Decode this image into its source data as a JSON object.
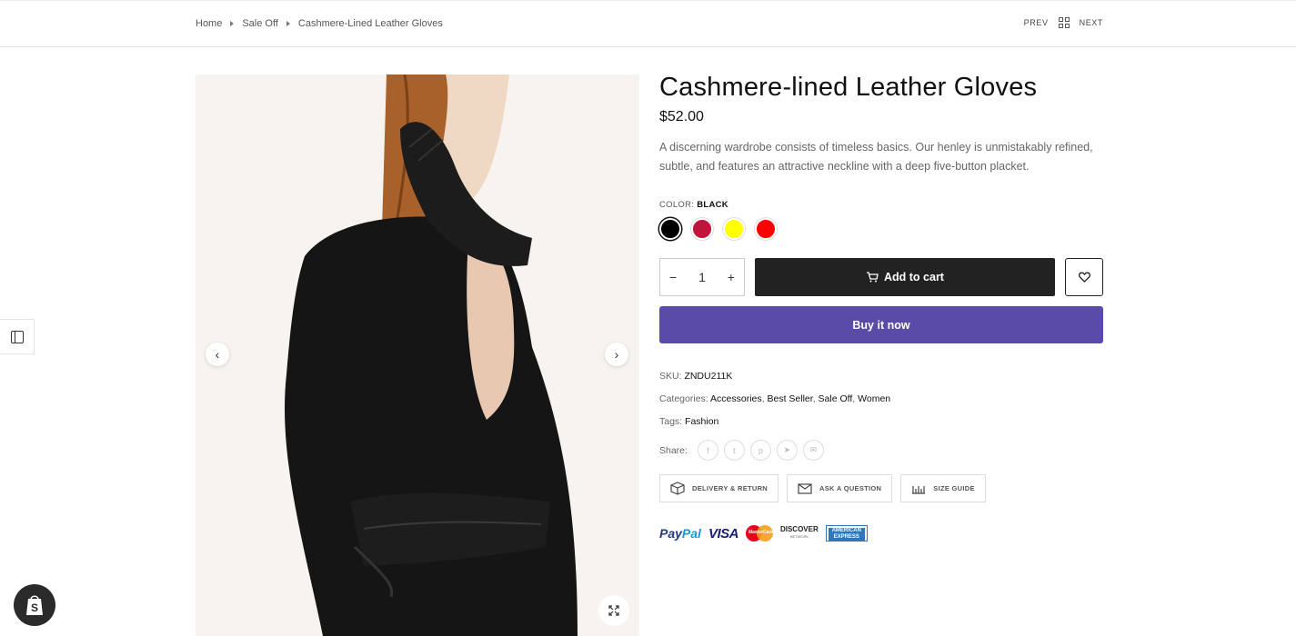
{
  "breadcrumb": {
    "items": [
      "Home",
      "Sale Off",
      "Cashmere-Lined Leather Gloves"
    ]
  },
  "pager": {
    "prev": "PREV",
    "next": "NEXT"
  },
  "product": {
    "title": "Cashmere-lined Leather Gloves",
    "price": "$52.00",
    "description": "A discerning wardrobe consists of timeless basics. Our henley is unmistakably refined, subtle, and features an attractive neckline with a deep five-button placket.",
    "color_label": "COLOR:",
    "color_value": "BLACK",
    "colors": [
      {
        "name": "black",
        "hex": "#000000",
        "selected": true
      },
      {
        "name": "crimson",
        "hex": "#c0143c",
        "selected": false
      },
      {
        "name": "yellow",
        "hex": "#ffff00",
        "selected": false
      },
      {
        "name": "red",
        "hex": "#ff0000",
        "selected": false
      }
    ],
    "quantity": "1",
    "add_to_cart": "Add to cart",
    "buy_now": "Buy it now",
    "sku_label": "SKU:",
    "sku": "ZNDU211K",
    "categories_label": "Categories:",
    "categories": [
      "Accessories",
      "Best Seller",
      "Sale Off",
      "Women"
    ],
    "tags_label": "Tags:",
    "tags": "Fashion",
    "share_label": "Share:",
    "share_icons": [
      "facebook-icon",
      "twitter-icon",
      "pinterest-icon",
      "telegram-icon",
      "email-icon"
    ]
  },
  "extras": {
    "delivery": "DELIVERY & RETURN",
    "ask": "ASK A QUESTION",
    "size": "SIZE GUIDE"
  },
  "payments": {
    "paypal_a": "Pay",
    "paypal_b": "Pal",
    "visa": "VISA",
    "mastercard": "MasterCard",
    "discover": "DISCOVER",
    "discover_sub": "NETWORK",
    "amex_a": "AMERICAN",
    "amex_b": "EXPRESS"
  },
  "colors": {
    "buy_now_bg": "#5a4ba9",
    "cart_bg": "#222222"
  }
}
